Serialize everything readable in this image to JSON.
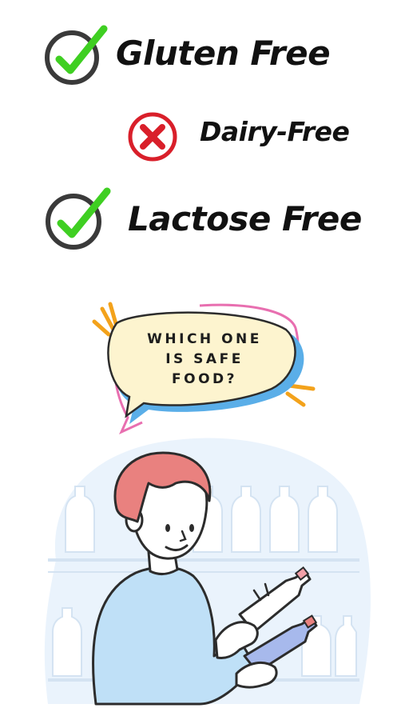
{
  "items": [
    {
      "label": "Gluten Free",
      "status": "check",
      "icon": "check-circle-icon"
    },
    {
      "label": "Dairy-Free",
      "status": "cross",
      "icon": "cross-circle-icon"
    },
    {
      "label": "Lactose Free",
      "status": "check",
      "icon": "check-circle-icon"
    }
  ],
  "bubble": {
    "lines": [
      "WHICH ONE",
      "IS SAFE",
      "FOOD?"
    ]
  },
  "colors": {
    "check": "#3fcf22",
    "cross": "#d91f2a",
    "ring": "#3a3a3a",
    "bubble_fill": "#fdf4cf",
    "bubble_outline_blue": "#5aaee8",
    "bubble_outline_pink": "#e86fb0",
    "accent_orange": "#f3a21b",
    "hair": "#e9817f",
    "sweater": "#bfe0f7",
    "shelf_bg": "#eaf3fc"
  }
}
